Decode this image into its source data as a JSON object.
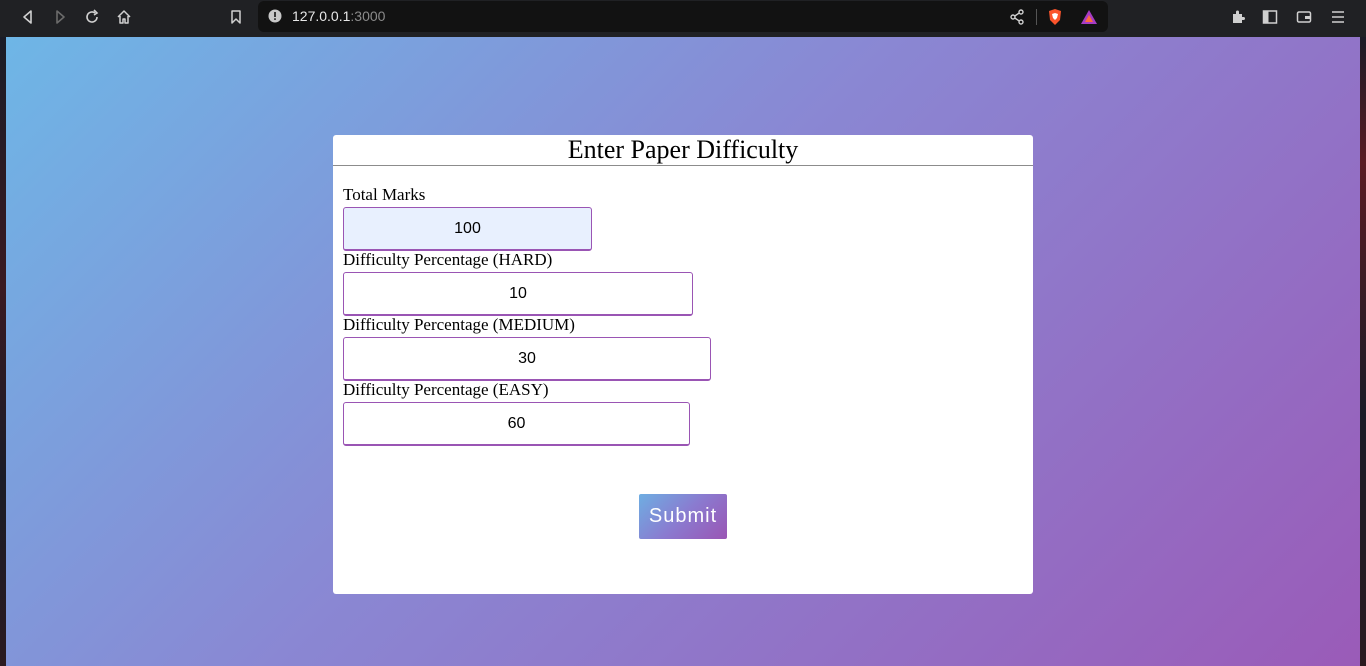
{
  "browser": {
    "url_host": "127.0.0.1",
    "url_port": ":3000",
    "icons": [
      "back-icon",
      "forward-icon",
      "reload-icon",
      "home-icon",
      "bookmark-icon",
      "site-info-icon",
      "share-icon",
      "brave-shields-icon",
      "brave-rewards-icon",
      "extensions-icon",
      "sidebar-icon",
      "wallet-icon",
      "menu-icon"
    ]
  },
  "form": {
    "title": "Enter Paper Difficulty",
    "fields": [
      {
        "label": "Total Marks",
        "value": "100"
      },
      {
        "label": "Difficulty Percentage (HARD)",
        "value": "10"
      },
      {
        "label": "Difficulty Percentage (MEDIUM)",
        "value": "30"
      },
      {
        "label": "Difficulty Percentage (EASY)",
        "value": "60"
      }
    ],
    "submit_label": "Submit"
  },
  "colors": {
    "gradient_start": "#6eb6e6",
    "gradient_end": "#9a5bb8",
    "input_border": "#9a55b4",
    "autofill_bg": "#e8f0fe"
  }
}
